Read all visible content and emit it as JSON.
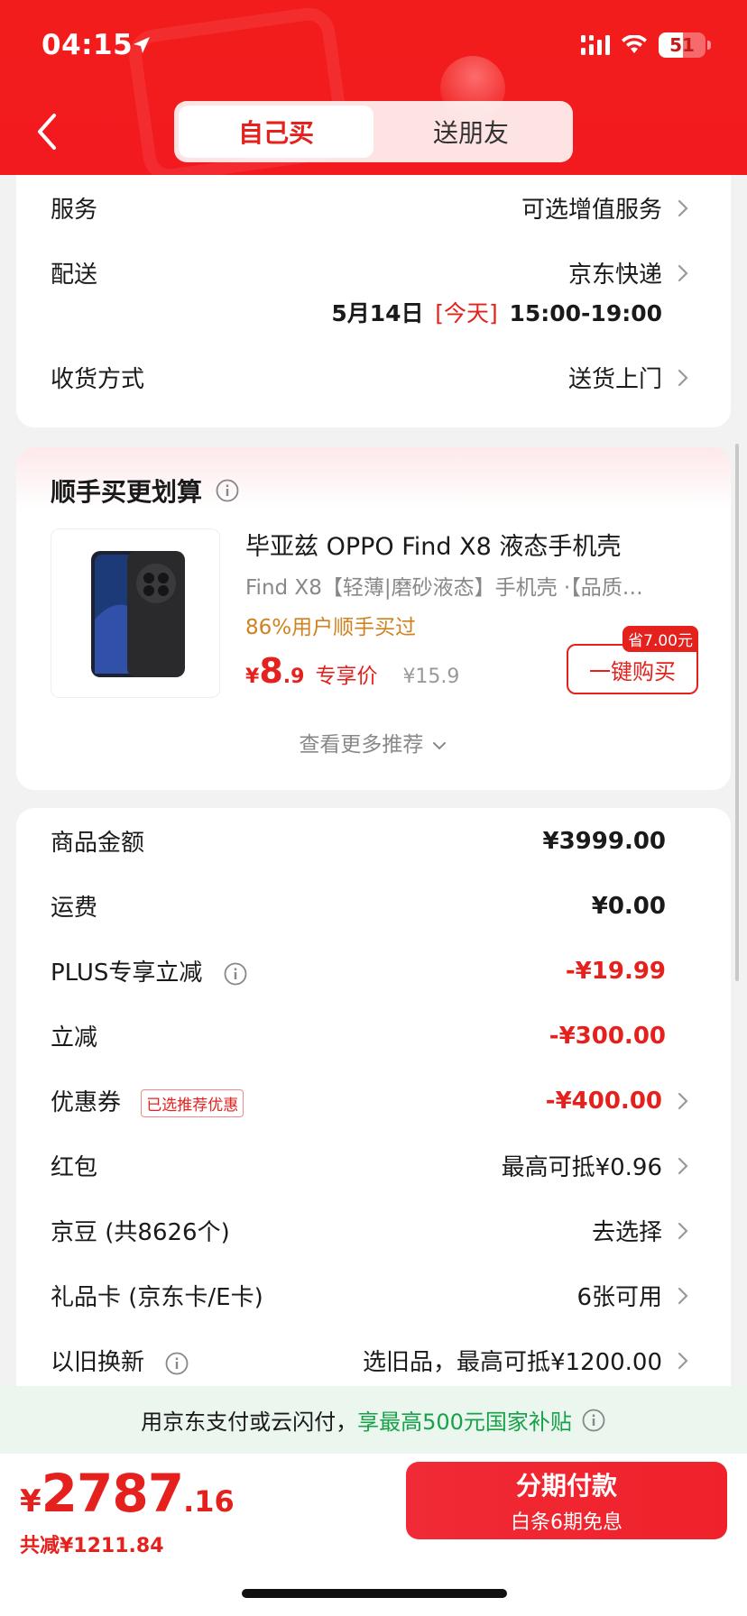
{
  "status_bar": {
    "time": "04:15",
    "battery": "51"
  },
  "header": {
    "tabs": [
      {
        "label": "自己买",
        "active": true
      },
      {
        "label": "送朋友",
        "active": false
      }
    ]
  },
  "delivery_card": {
    "service_label": "服务",
    "service_value": "可选增值服务",
    "shipping_label": "配送",
    "shipping_value": "京东快递",
    "shipping_date": "5月14日",
    "shipping_today": "[今天]",
    "shipping_window": "15:00-19:00",
    "receive_label": "收货方式",
    "receive_value": "送货上门"
  },
  "recommend": {
    "title": "顺手买更划算",
    "product_name": "毕亚兹 OPPO Find X8 液态手机壳",
    "product_sub": "Find X8【轻薄|磨砂液态】手机壳 ·【品质…",
    "hint": "86%用户顺手买过",
    "price_symbol": "¥",
    "price_int": "8",
    "price_dec": ".9",
    "price_tag": "专享价",
    "orig_price": "¥15.9",
    "save_badge": "省7.00元",
    "buy_label": "一键购买",
    "more_label": "查看更多推荐"
  },
  "summary": {
    "rows": [
      {
        "label": "商品金额",
        "value": "¥3999.00"
      },
      {
        "label": "运费",
        "value": "¥0.00"
      },
      {
        "label": "PLUS专享立减",
        "value": "-¥19.99"
      },
      {
        "label": "立减",
        "value": "-¥300.00"
      },
      {
        "label": "优惠券",
        "tag": "已选推荐优惠",
        "value": "-¥400.00"
      },
      {
        "label": "红包",
        "value": "最高可抵¥0.96"
      },
      {
        "label": "京豆 (共8626个)",
        "value": "去选择"
      },
      {
        "label": "礼品卡 (京东卡/E卡)",
        "value": "6张可用"
      },
      {
        "label": "以旧换新",
        "value": "选旧品，最高可抵¥1200.00"
      }
    ]
  },
  "subsidy": {
    "prefix": "用京东支付或云闪付，",
    "highlight": "享最高500元国家补贴"
  },
  "bottom_bar": {
    "price_symbol": "¥",
    "price_int": "2787",
    "price_dec": ".16",
    "saved": "共减¥1211.84",
    "pay_title": "分期付款",
    "pay_sub": "白条6期免息"
  },
  "colors": {
    "brand_red": "#e4211c",
    "header_red": "#f21c1c",
    "subsidy_green": "#18a149"
  }
}
